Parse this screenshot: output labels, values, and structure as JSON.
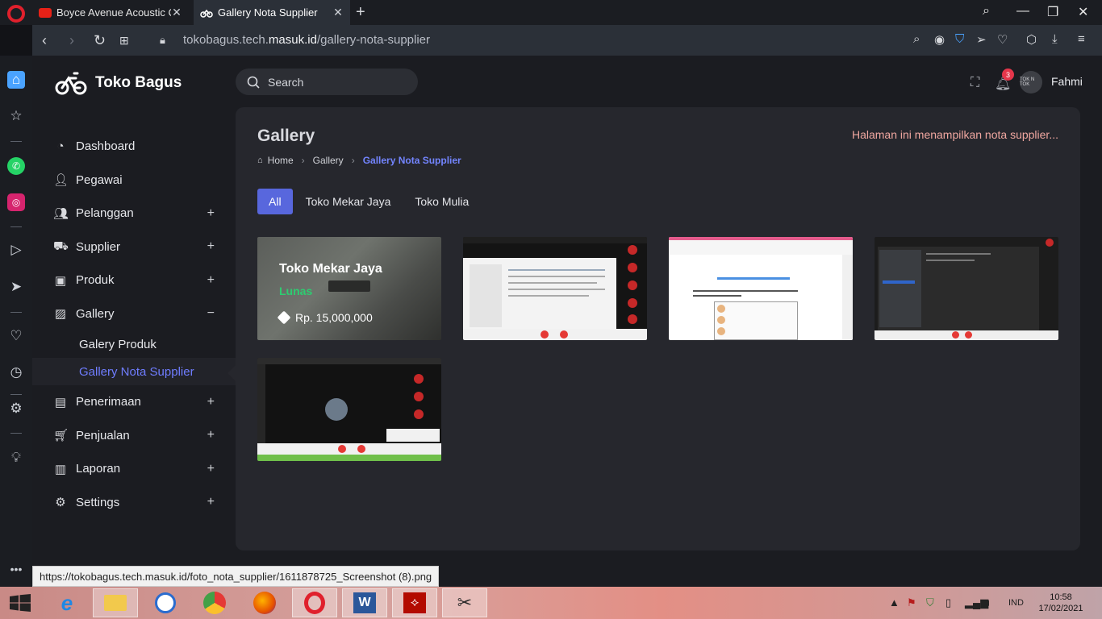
{
  "browser": {
    "tabs": [
      {
        "title": "Boyce Avenue Acoustic Co",
        "active": false
      },
      {
        "title": "Gallery Nota Supplier",
        "active": true
      }
    ],
    "url_prefix": "tokobagus.tech.",
    "url_domain": "masuk.id",
    "url_path": "/gallery-nota-supplier",
    "status_url": "https://tokobagus.tech.masuk.id/foto_nota_supplier/1611878725_Screenshot (8).png"
  },
  "app": {
    "brand": "Toko Bagus",
    "search_placeholder": "Search",
    "notifications_count": "3",
    "avatar_text": "TOK N TOK",
    "user_name": "Fahmi"
  },
  "sidebar": {
    "items": [
      {
        "label": "Dashboard",
        "icon": "dashboard-icon",
        "expand": ""
      },
      {
        "label": "Pegawai",
        "icon": "user-check-icon",
        "expand": ""
      },
      {
        "label": "Pelanggan",
        "icon": "users-icon",
        "expand": "+"
      },
      {
        "label": "Supplier",
        "icon": "truck-icon",
        "expand": "+"
      },
      {
        "label": "Produk",
        "icon": "briefcase-icon",
        "expand": "+"
      },
      {
        "label": "Gallery",
        "icon": "image-icon",
        "expand": "−"
      },
      {
        "label": "Penerimaan",
        "icon": "inbox-icon",
        "expand": "+"
      },
      {
        "label": "Penjualan",
        "icon": "cart-icon",
        "expand": "+"
      },
      {
        "label": "Laporan",
        "icon": "bar-chart-icon",
        "expand": "+"
      },
      {
        "label": "Settings",
        "icon": "cog-icon",
        "expand": "+"
      }
    ],
    "gallery_sub": [
      {
        "label": "Galery Produk",
        "active": false
      },
      {
        "label": "Gallery Nota Supplier",
        "active": true
      }
    ]
  },
  "page": {
    "title": "Gallery",
    "description": "Halaman ini menampilkan nota supplier...",
    "breadcrumb": [
      "Home",
      "Gallery",
      "Gallery Nota Supplier"
    ],
    "filters": [
      {
        "label": "All",
        "active": true
      },
      {
        "label": "Toko Mekar Jaya",
        "active": false
      },
      {
        "label": "Toko Mulia",
        "active": false
      }
    ],
    "hover_card": {
      "name": "Toko Mekar Jaya",
      "status": "Lunas",
      "price": "Rp. 15,000,000"
    },
    "gallery_count": 5
  },
  "taskbar": {
    "language": "IND",
    "time": "10:58",
    "date": "17/02/2021"
  },
  "colors": {
    "accent": "#5867dd",
    "accent_text": "#7385ff",
    "status_green": "#2ecc71",
    "desc_text": "#f0a7a0",
    "opera_red": "#e0202c"
  }
}
